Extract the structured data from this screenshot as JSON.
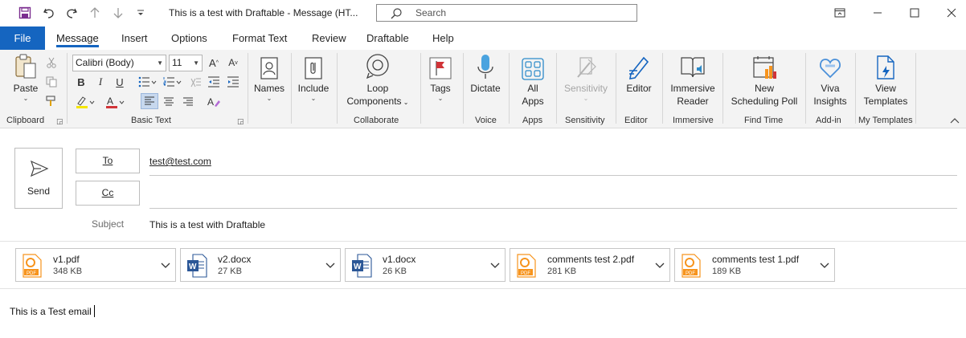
{
  "window": {
    "title": "This is a test with Draftable  -  Message (HT...",
    "search_placeholder": "Search"
  },
  "tabs": [
    {
      "label": "File"
    },
    {
      "label": "Message"
    },
    {
      "label": "Insert"
    },
    {
      "label": "Options"
    },
    {
      "label": "Format Text"
    },
    {
      "label": "Review"
    },
    {
      "label": "Draftable"
    },
    {
      "label": "Help"
    }
  ],
  "ribbon": {
    "clipboard": {
      "paste_label": "Paste",
      "group_label": "Clipboard"
    },
    "basic_text": {
      "font_name": "Calibri (Body)",
      "font_size": "11",
      "group_label": "Basic Text"
    },
    "names": {
      "label": "Names"
    },
    "include": {
      "label": "Include"
    },
    "collaborate": {
      "loop_label_1": "Loop",
      "loop_label_2": "Components",
      "group_label": "Collaborate"
    },
    "tags": {
      "label": "Tags"
    },
    "voice": {
      "dictate_label": "Dictate",
      "group_label": "Voice"
    },
    "apps": {
      "label_1": "All",
      "label_2": "Apps",
      "group_label": "Apps"
    },
    "sensitivity": {
      "label": "Sensitivity",
      "group_label": "Sensitivity"
    },
    "editor": {
      "label": "Editor",
      "group_label": "Editor"
    },
    "immersive": {
      "label_1": "Immersive",
      "label_2": "Reader",
      "group_label": "Immersive"
    },
    "find_time": {
      "label_1": "New",
      "label_2": "Scheduling Poll",
      "group_label": "Find Time"
    },
    "add_in": {
      "label_1": "Viva",
      "label_2": "Insights",
      "group_label": "Add-in"
    },
    "my_templates": {
      "label_1": "View",
      "label_2": "Templates",
      "group_label": "My Templates"
    }
  },
  "compose": {
    "send_label": "Send",
    "to_label": "To",
    "to_value": "test@test.com",
    "cc_label": "Cc",
    "cc_value": "",
    "subject_label": "Subject",
    "subject_value": "This is a test with Draftable"
  },
  "attachments": [
    {
      "name": "v1.pdf",
      "size": "348 KB",
      "type": "pdf"
    },
    {
      "name": "v2.docx",
      "size": "27 KB",
      "type": "word"
    },
    {
      "name": "v1.docx",
      "size": "26 KB",
      "type": "word"
    },
    {
      "name": "comments test 2.pdf",
      "size": "281 KB",
      "type": "pdf"
    },
    {
      "name": "comments test 1.pdf",
      "size": "189 KB",
      "type": "pdf"
    }
  ],
  "body": {
    "text": "This is a Test email"
  },
  "colors": {
    "accent": "#1565c0",
    "pdf_orange": "#f7941d",
    "word_blue": "#2b5797",
    "flag_red": "#d13438"
  },
  "icons": [
    "save-icon",
    "undo-icon",
    "redo-icon",
    "up-arrow-icon",
    "down-arrow-icon",
    "customize-icon",
    "search-icon",
    "restore-icon",
    "minimize-icon",
    "maximize-icon",
    "close-icon"
  ]
}
